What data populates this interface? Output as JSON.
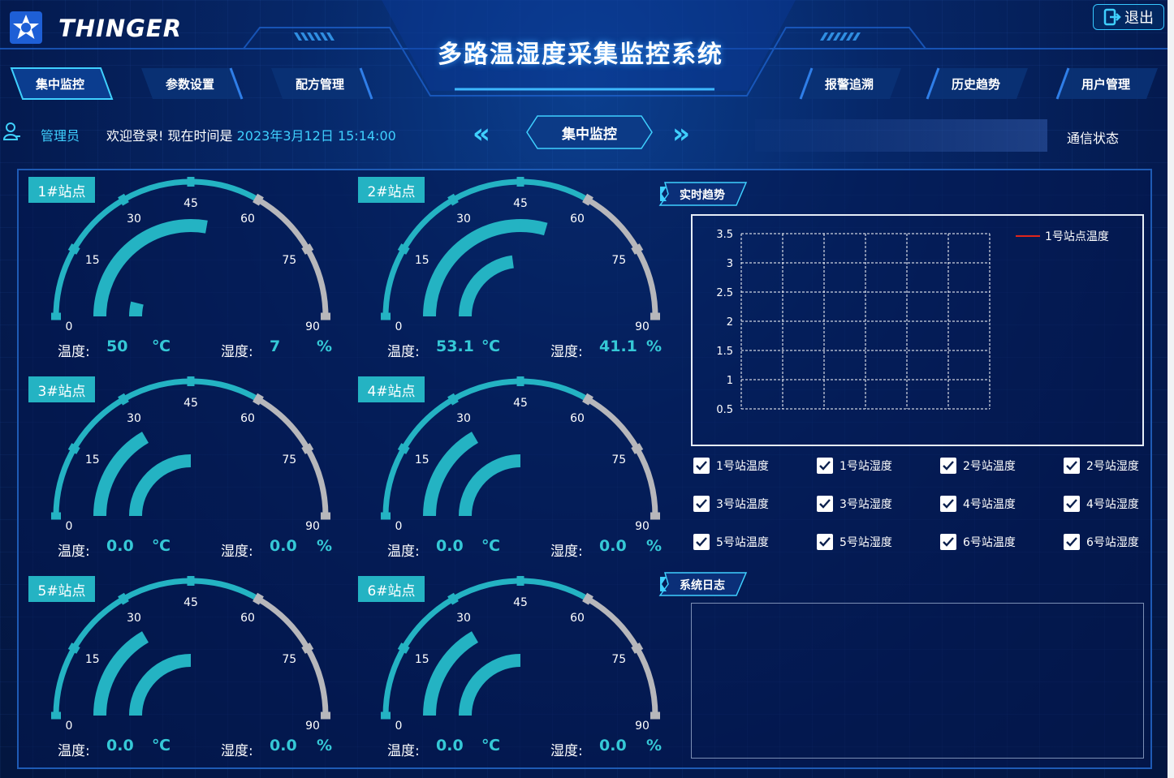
{
  "header": {
    "app_name": "THINGER",
    "system_title": "多路温湿度采集监控系统",
    "exit_label": "退出"
  },
  "nav": {
    "tabs": [
      {
        "label": "集中监控",
        "active": true
      },
      {
        "label": "参数设置",
        "active": false
      },
      {
        "label": "配方管理",
        "active": false
      },
      {
        "label": "报警追溯",
        "active": false
      },
      {
        "label": "历史趋势",
        "active": false
      },
      {
        "label": "用户管理",
        "active": false
      }
    ]
  },
  "status_bar": {
    "user_role": "管理员",
    "welcome_text": "欢迎登录! 现在时间是 ",
    "current_time": "2023年3月12日 15:14:00",
    "prev_icon": "«",
    "next_icon": "»",
    "current_page": "集中监控",
    "comm_status_label": "通信状态"
  },
  "gauge_ticks": [
    "0",
    "15",
    "30",
    "45",
    "60",
    "75",
    "90"
  ],
  "stations": [
    {
      "name": "1#站点",
      "temp_label": "温度:",
      "temp_value": "50",
      "temp_unit": "℃",
      "hum_label": "湿度:",
      "hum_value": "7",
      "hum_unit": "%",
      "temp": 50,
      "hum": 7
    },
    {
      "name": "2#站点",
      "temp_label": "温度:",
      "temp_value": "53.1",
      "temp_unit": "℃",
      "hum_label": "湿度:",
      "hum_value": "41.1",
      "hum_unit": "%",
      "temp": 53.1,
      "hum": 41.1
    },
    {
      "name": "3#站点",
      "temp_label": "温度:",
      "temp_value": "0.0",
      "temp_unit": "℃",
      "hum_label": "湿度:",
      "hum_value": "0.0",
      "hum_unit": "%",
      "temp": 0,
      "hum": 0
    },
    {
      "name": "4#站点",
      "temp_label": "温度:",
      "temp_value": "0.0",
      "temp_unit": "℃",
      "hum_label": "湿度:",
      "hum_value": "0.0",
      "hum_unit": "%",
      "temp": 0,
      "hum": 0
    },
    {
      "name": "5#站点",
      "temp_label": "温度:",
      "temp_value": "0.0",
      "temp_unit": "℃",
      "hum_label": "湿度:",
      "hum_value": "0.0",
      "hum_unit": "%",
      "temp": 0,
      "hum": 0
    },
    {
      "name": "6#站点",
      "temp_label": "温度:",
      "temp_value": "0.0",
      "temp_unit": "℃",
      "hum_label": "湿度:",
      "hum_value": "0.0",
      "hum_unit": "%",
      "temp": 0,
      "hum": 0
    }
  ],
  "trend": {
    "section_label": "实时趋势",
    "legend": "1号站点温度",
    "legend_color": "#e0251b",
    "y_ticks": [
      "3.5",
      "3",
      "2.5",
      "2",
      "1.5",
      "1",
      "0.5"
    ]
  },
  "chart_data": {
    "type": "line",
    "title": "",
    "series": [
      {
        "name": "1号站点温度",
        "values": []
      }
    ],
    "ylim": [
      0.5,
      3.5
    ],
    "yticks": [
      0.5,
      1,
      1.5,
      2,
      2.5,
      3,
      3.5
    ],
    "grid": true,
    "legend_position": "top-right"
  },
  "checkboxes": [
    {
      "label": "1号站温度",
      "checked": true
    },
    {
      "label": "1号站湿度",
      "checked": true
    },
    {
      "label": "2号站温度",
      "checked": true
    },
    {
      "label": "2号站湿度",
      "checked": true
    },
    {
      "label": "3号站温度",
      "checked": true
    },
    {
      "label": "3号站湿度",
      "checked": true
    },
    {
      "label": "4号站温度",
      "checked": true
    },
    {
      "label": "4号站湿度",
      "checked": true
    },
    {
      "label": "5号站温度",
      "checked": true
    },
    {
      "label": "5号站湿度",
      "checked": true
    },
    {
      "label": "6号站温度",
      "checked": true
    },
    {
      "label": "6号站湿度",
      "checked": true
    }
  ],
  "log": {
    "section_label": "系统日志"
  },
  "colors": {
    "accent": "#24b3c3",
    "highlight": "#3fd0ff",
    "gauge_warn": "#b7b7bb"
  }
}
